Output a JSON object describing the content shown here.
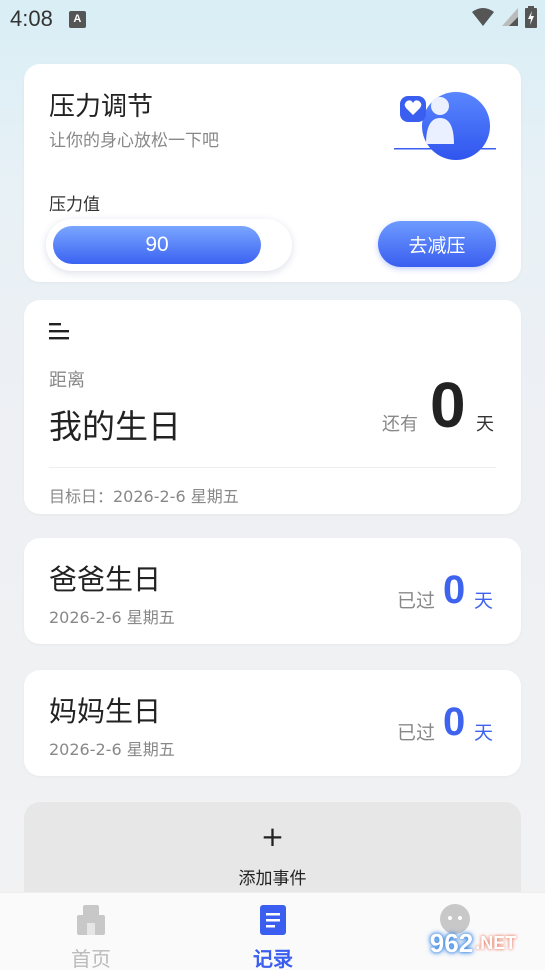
{
  "status_bar": {
    "time": "4:08",
    "notification_letter": "A"
  },
  "stress_card": {
    "title": "压力调节",
    "subtitle": "让你的身心放松一下吧",
    "stress_label": "压力值",
    "stress_value": "90",
    "relieve_button": "去减压",
    "accent_color": "#3a5ef0"
  },
  "main_event": {
    "distance_label": "距离",
    "name": "我的生日",
    "remain_label": "还有",
    "count": "0",
    "day_unit": "天",
    "target_date": "目标日：2026-2-6 星期五"
  },
  "events": [
    {
      "name": "爸爸生日",
      "date": "2026-2-6 星期五",
      "status_label": "已过",
      "count": "0",
      "day_unit": "天"
    },
    {
      "name": "妈妈生日",
      "date": "2026-2-6 星期五",
      "status_label": "已过",
      "count": "0",
      "day_unit": "天"
    }
  ],
  "add_event": {
    "plus": "+",
    "label": "添加事件"
  },
  "bottom_nav": {
    "items": [
      {
        "label": "首页",
        "icon": "home-icon",
        "active": false
      },
      {
        "label": "记录",
        "icon": "record-icon",
        "active": true
      }
    ]
  },
  "watermark": {
    "text": "962",
    "suffix": ".NET"
  }
}
